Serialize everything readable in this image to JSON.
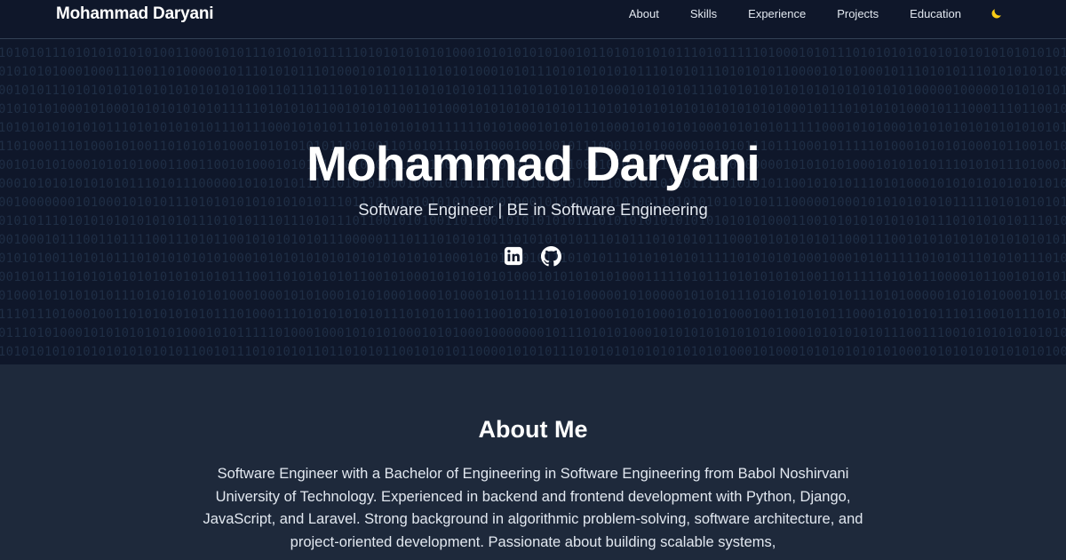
{
  "nav": {
    "brand": "Mohammad Daryani",
    "links": [
      "About",
      "Skills",
      "Experience",
      "Projects",
      "Education"
    ],
    "theme_icon": "moon-icon"
  },
  "hero": {
    "name": "Mohammad Daryani",
    "subtitle": "Software Engineer | BE in Software Engineering",
    "social_icons": [
      "linkedin-icon",
      "github-icon"
    ],
    "background_pattern": "binary digits (0/1)"
  },
  "about": {
    "title": "About Me",
    "text": "Software Engineer with a Bachelor of Engineering in Software Engineering from Babol Noshirvani University of Technology. Experienced in backend and frontend development with Python, Django, JavaScript, and Laravel. Strong background in algorithmic problem-solving, software architecture, and project-oriented development. Passionate about building scalable systems,"
  },
  "colors": {
    "nav_bg": "#0f172a",
    "hero_bg": "#0f172a",
    "section_bg": "#1e293b",
    "text": "#ffffff",
    "muted_text": "#e2e8f0",
    "binary_text": "#1f2e45",
    "moon": "#facc15"
  }
}
